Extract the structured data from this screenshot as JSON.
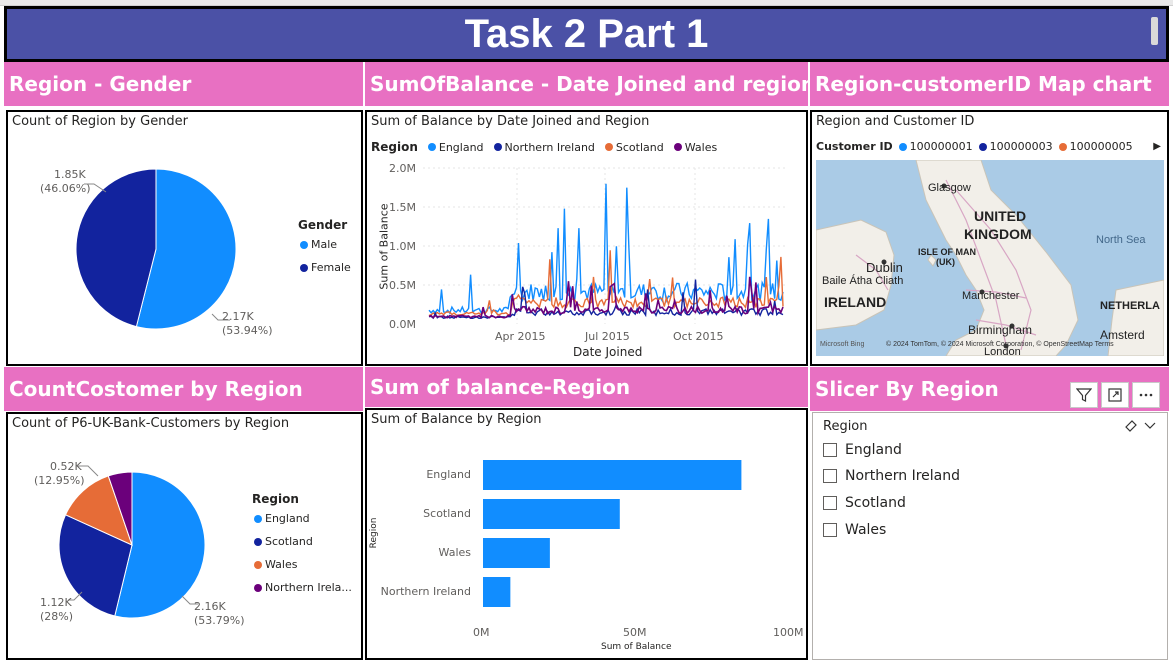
{
  "header": {
    "title": "Task 2 Part 1"
  },
  "sections": {
    "region_gender": "Region - Gender",
    "balance_date": "SumOfBalance - Date Joined and region",
    "map": "Region-customerID Map chart",
    "count_region": "CountCostomer by Region",
    "balance_region": "Sum of balance-Region",
    "slicer": "Slicer By Region"
  },
  "gender_pie": {
    "title": "Count of Region by Gender",
    "legend_title": "Gender",
    "labels": [
      {
        "name": "Male",
        "value": "2.17K",
        "pct": "(53.94%)",
        "fraction": 0.5394,
        "color": "#118dff"
      },
      {
        "name": "Female",
        "value": "1.85K",
        "pct": "(46.06%)",
        "fraction": 0.4606,
        "color": "#12239e"
      }
    ]
  },
  "balance_line": {
    "title": "Sum of Balance by Date Joined and Region",
    "legend_title": "Region",
    "series": [
      {
        "name": "England",
        "color": "#118dff"
      },
      {
        "name": "Northern Ireland",
        "color": "#12239e"
      },
      {
        "name": "Scotland",
        "color": "#e66c37"
      },
      {
        "name": "Wales",
        "color": "#6b007b"
      }
    ],
    "yticks": [
      "2.0M",
      "1.5M",
      "1.0M",
      "0.5M",
      "0.0M"
    ],
    "xticks": [
      "Apr 2015",
      "Jul 2015",
      "Oct 2015"
    ],
    "xlabel": "Date Joined",
    "ylabel": "Sum of Balance"
  },
  "map_chart": {
    "title": "Region and Customer ID",
    "legend_title": "Customer ID",
    "legend": [
      {
        "name": "100000001",
        "color": "#118dff"
      },
      {
        "name": "100000003",
        "color": "#12239e"
      },
      {
        "name": "100000005",
        "color": "#e66c37"
      }
    ],
    "places": {
      "glasgow": "Glasgow",
      "uk1": "UNITED",
      "uk2": "KINGDOM",
      "northsea": "North Sea",
      "isle1": "ISLE OF MAN",
      "isle2": "(UK)",
      "dublin": "Dublin",
      "baile": "Baile Átha Cliath",
      "ireland": "IRELAND",
      "manchester": "Manchester",
      "birmingham": "Birmingham",
      "netherlands": "NETHERLA",
      "amsterdam": "Amsterd",
      "london": "London"
    },
    "credits": "© 2024 TomTom, © 2024 Microsoft Corporation, © OpenStreetMap  Terms",
    "bing": "Microsoft Bing"
  },
  "count_pie": {
    "title": "Count of P6-UK-Bank-Customers by Region",
    "legend_title": "Region",
    "slices": [
      {
        "name": "England",
        "value": "2.16K",
        "pct": "(53.79%)",
        "fraction": 0.5379,
        "color": "#118dff"
      },
      {
        "name": "Scotland",
        "value": "1.12K",
        "pct": "(28%)",
        "fraction": 0.28,
        "color": "#12239e"
      },
      {
        "name": "Wales",
        "value": "0.52K",
        "pct": "(12.95%)",
        "fraction": 0.1295,
        "color": "#e66c37"
      },
      {
        "name": "Northern Irela...",
        "value": "",
        "pct": "",
        "fraction": 0.0526,
        "color": "#6b007b"
      }
    ]
  },
  "chart_data": {
    "type": "bar",
    "title": "Sum of Balance by Region",
    "categories": [
      "England",
      "Scotland",
      "Wales",
      "Northern Ireland"
    ],
    "values": [
      85,
      45,
      22,
      9
    ],
    "xlim": [
      0,
      100
    ],
    "xticks": [
      "0M",
      "50M",
      "100M"
    ],
    "xlabel": "Sum of Balance",
    "ylabel": "Region",
    "color": "#118dff"
  },
  "slicer": {
    "title": "Region",
    "items": [
      "England",
      "Northern Ireland",
      "Scotland",
      "Wales"
    ]
  }
}
